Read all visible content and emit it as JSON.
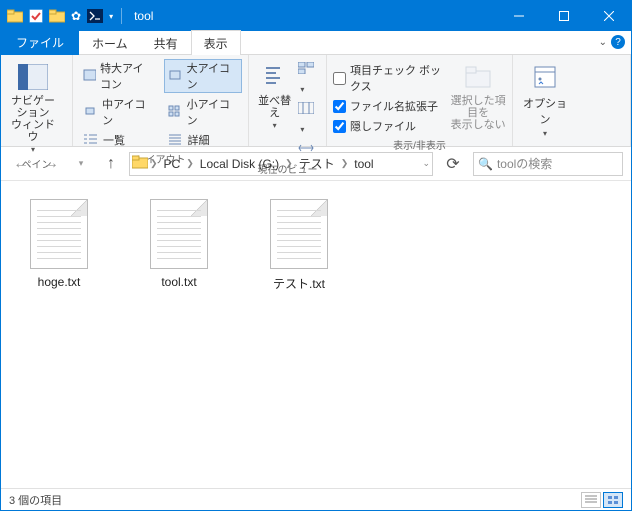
{
  "window": {
    "title": "tool"
  },
  "tabs": {
    "file": "ファイル",
    "home": "ホーム",
    "share": "共有",
    "view": "表示"
  },
  "ribbon": {
    "pane": {
      "nav": "ナビゲーション\nウィンドウ",
      "label": "ペイン"
    },
    "layout": {
      "xl": "特大アイコン",
      "l": "大アイコン",
      "m": "中アイコン",
      "s": "小アイコン",
      "list": "一覧",
      "details": "詳細",
      "label": "レイアウト"
    },
    "currentview": {
      "sort": "並べ替え",
      "label": "現在のビュー"
    },
    "showhide": {
      "chk1": "項目チェック ボックス",
      "chk2": "ファイル名拡張子",
      "chk3": "隠しファイル",
      "hidebtn": "選択した項目を\n表示しない",
      "label": "表示/非表示"
    },
    "options": {
      "btn": "オプション"
    }
  },
  "breadcrumb": {
    "pc": "PC",
    "disk": "Local Disk (G:)",
    "test": "テスト",
    "tool": "tool"
  },
  "search": {
    "placeholder": "toolの検索"
  },
  "files": [
    "hoge.txt",
    "tool.txt",
    "テスト.txt"
  ],
  "status": {
    "count": "3 個の項目"
  }
}
